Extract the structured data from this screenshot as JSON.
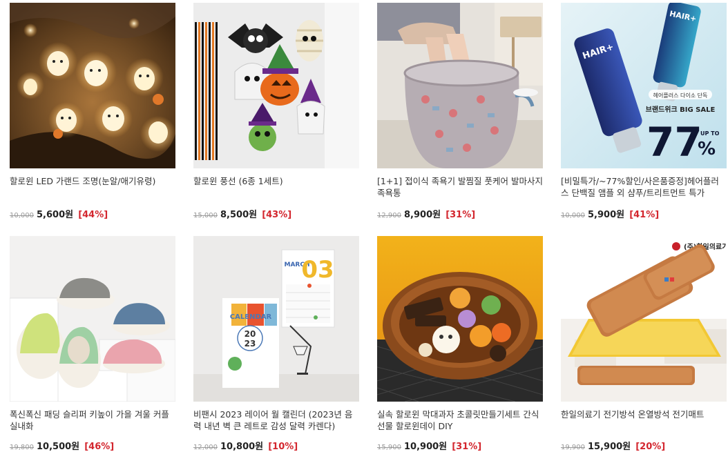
{
  "products": [
    {
      "title": "할로윈 LED 가랜드 조명(눈알/애기유령)",
      "original_price": "10,000",
      "sale_price": "5,600원",
      "discount": "[44%]",
      "image": "ghost-led-garland"
    },
    {
      "title": "할로윈 풍선 (6종 1세트)",
      "original_price": "15,000",
      "sale_price": "8,500원",
      "discount": "[43%]",
      "image": "halloween-balloons"
    },
    {
      "title": "[1+1] 접이식 족욕기 발찜질 풋케어 발마사지 족욕통",
      "original_price": "12,900",
      "sale_price": "8,900원",
      "discount": "[31%]",
      "image": "foldable-foot-bath"
    },
    {
      "title": "[비밀특가/~77%할인/사은품증정]헤어플러스 단백질 앰플 외 샴푸/트리트먼트 특가",
      "original_price": "10,000",
      "sale_price": "5,900원",
      "discount": "[41%]",
      "image": "hair-ampoule",
      "image_text": {
        "brand": "HAIR+",
        "banner": "헤어플러스 다이소 단독",
        "sale": "브랜드위크 BIG SALE",
        "percent": "77",
        "upto": "UP TO",
        "pct_sign": "%"
      }
    },
    {
      "title": "폭신폭신 패딩 슬리퍼 키높이 가을 겨울 커플 실내화",
      "original_price": "19,800",
      "sale_price": "10,500원",
      "discount": "[46%]",
      "image": "padded-slippers"
    },
    {
      "title": "비팬시 2023 레이어 월 캘린더 (2023년 음력 내년 벽 큰 레트로 감성 달력 카렌다)",
      "original_price": "12,000",
      "sale_price": "10,800원",
      "discount": "[10%]",
      "image": "wall-calendar",
      "image_text": {
        "calendar": "CALENDAR",
        "year_top": "20",
        "year_bottom": "23",
        "month": "MARCH",
        "month_num": "03"
      }
    },
    {
      "title": "실속 할로윈 막대과자 초콜릿만들기세트 간식 선물 할로윈데이 DIY",
      "original_price": "15,900",
      "sale_price": "10,900원",
      "discount": "[31%]",
      "image": "halloween-chocolates"
    },
    {
      "title": "한일의료기 전기방석 온열방석 전기매트",
      "original_price": "19,900",
      "sale_price": "15,900원",
      "discount": "[20%]",
      "image": "electric-heating-pad",
      "image_text": {
        "brand": "(주)한일의료기"
      }
    }
  ]
}
